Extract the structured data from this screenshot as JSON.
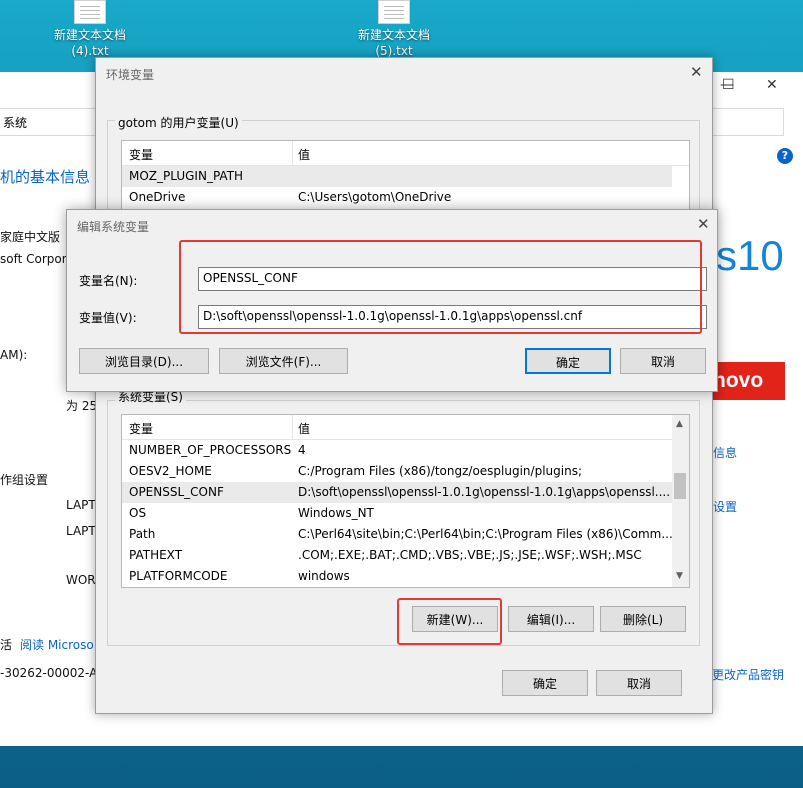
{
  "desktop": {
    "icons": [
      {
        "label_line1": "新建文本文档",
        "label_line2": "(4).txt"
      },
      {
        "label_line1": "新建文本文档",
        "label_line2": "(5).txt"
      }
    ]
  },
  "system_window": {
    "caption": {
      "minimize": "—",
      "maximize": "☐",
      "close": "✕"
    },
    "address": "系统",
    "heading": "机的基本信息",
    "edition": "家庭中文版",
    "company": "soft Corpor",
    "win_logo_text": "s10",
    "ram_label": "AM):",
    "cpu_partial": "为 25",
    "workgroup_label": "作组设置",
    "host1": "LAPT",
    "host2": "LAPT",
    "workgroup": "WOR",
    "activation_prefix": "活",
    "read_ms": "阅读 Microso",
    "product_id": "-30262-00002-AA",
    "lenovo": "novo",
    "support_info": "信息",
    "change_settings": "设置",
    "change_key": "更改产品密钥",
    "help_icon": "?"
  },
  "env_dialog": {
    "title": "环境变量",
    "close": "✕",
    "user_group_label": "gotom 的用户变量(U)",
    "columns": {
      "name": "变量",
      "value": "值"
    },
    "user_vars": [
      {
        "name": "MOZ_PLUGIN_PATH",
        "value": ""
      },
      {
        "name": "OneDrive",
        "value": "C:\\Users\\gotom\\OneDrive"
      }
    ],
    "system_group_label": "系统变量(S)",
    "system_vars": [
      {
        "name": "NUMBER_OF_PROCESSORS",
        "value": "4"
      },
      {
        "name": "OESV2_HOME",
        "value": "C:/Program Files (x86)/tongz/oesplugin/plugins;"
      },
      {
        "name": "OPENSSL_CONF",
        "value": "D:\\soft\\openssl\\openssl-1.0.1g\\openssl-1.0.1g\\apps\\openssl...."
      },
      {
        "name": "OS",
        "value": "Windows_NT"
      },
      {
        "name": "Path",
        "value": "C:\\Perl64\\site\\bin;C:\\Perl64\\bin;C:\\Program Files (x86)\\Comm..."
      },
      {
        "name": "PATHEXT",
        "value": ".COM;.EXE;.BAT;.CMD;.VBS;.VBE;.JS;.JSE;.WSF;.WSH;.MSC"
      },
      {
        "name": "PLATFORMCODE",
        "value": "windows"
      }
    ],
    "buttons": {
      "new": "新建(W)...",
      "edit": "编辑(I)...",
      "delete": "删除(L)",
      "ok": "确定",
      "cancel": "取消"
    }
  },
  "edit_dialog": {
    "title": "编辑系统变量",
    "close": "✕",
    "name_label": "变量名(N):",
    "name_value": "OPENSSL_CONF",
    "value_label": "变量值(V):",
    "value_value": "D:\\soft\\openssl\\openssl-1.0.1g\\openssl-1.0.1g\\apps\\openssl.cnf",
    "buttons": {
      "browse_dir": "浏览目录(D)...",
      "browse_file": "浏览文件(F)...",
      "ok": "确定",
      "cancel": "取消"
    }
  },
  "colors": {
    "highlight": "#e53935",
    "link": "#0a64c8",
    "lenovo": "#e2231a"
  }
}
